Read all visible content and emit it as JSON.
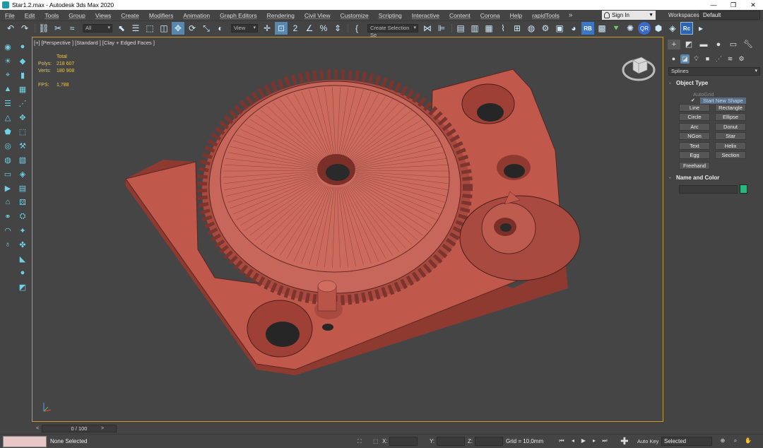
{
  "window": {
    "title": "Star1.2.max - Autodesk 3ds Max 2020",
    "controls": [
      "—",
      "❐",
      "✕"
    ]
  },
  "menu": {
    "items": [
      "File",
      "Edit",
      "Tools",
      "Group",
      "Views",
      "Create",
      "Modifiers",
      "Animation",
      "Graph Editors",
      "Rendering",
      "Civil View",
      "Customize",
      "Scripting",
      "Interactive",
      "Content",
      "Corona",
      "Help",
      "rapidTools"
    ],
    "more": "»",
    "sign_in": "Sign In",
    "workspaces_label": "Workspaces:",
    "workspace_value": "Default"
  },
  "toolbar": {
    "filter_value": "All",
    "ref_coord_value": "View",
    "selection_set_placeholder": "Create Selection Se"
  },
  "viewport": {
    "label": "[+] [Perspective ] [Standard ] [Clay + Edged Faces ]",
    "stats": {
      "header": "Total",
      "polys_label": "Polys:",
      "polys_value": "218 607",
      "verts_label": "Verts:",
      "verts_value": "180 908",
      "fps_label": "FPS:",
      "fps_value": "1,788"
    },
    "model_color": "#c0594c"
  },
  "timeline": {
    "frame_display": "0 / 100",
    "prev": "<",
    "next": ">"
  },
  "status": {
    "selection_text": "None Selected",
    "x_label": "X:",
    "y_label": "Y:",
    "z_label": "Z:",
    "grid_text": "Grid = 10,0mm",
    "auto_key": "Auto Key",
    "key_mode": "Selected"
  },
  "command_panel": {
    "category": "Splines",
    "object_type_title": "Object Type",
    "autogrid": "AutoGrid",
    "start_new_shape": "Start New Shape",
    "buttons": [
      "Line",
      "Rectangle",
      "Circle",
      "Ellipse",
      "Arc",
      "Donut",
      "NGon",
      "Star",
      "Text",
      "Helix",
      "Egg",
      "Section",
      "Freehand"
    ],
    "name_color_title": "Name and Color",
    "object_color": "#26b87e"
  }
}
